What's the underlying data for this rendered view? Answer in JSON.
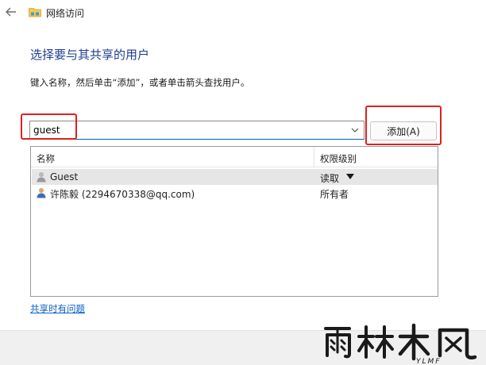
{
  "window": {
    "title": "网络访问",
    "back_icon": "back-arrow-icon",
    "folder_icon": "folder-network-icon"
  },
  "page": {
    "heading": "选择要与其共享的用户",
    "instruction": "键入名称，然后单击“添加”，或者单击箭头查找用户。"
  },
  "user_input": {
    "value": "guest",
    "dropdown_icon": "chevron-down-icon"
  },
  "add_button": {
    "label": "添加(A)"
  },
  "table": {
    "columns": [
      "名称",
      "权限级别"
    ],
    "rows": [
      {
        "name": "Guest",
        "permission": "读取",
        "selected": true,
        "has_dropdown": true
      },
      {
        "name": "许陈毅 (2294670338@qq.com)",
        "permission": "所有者",
        "selected": false,
        "has_dropdown": false
      }
    ]
  },
  "help_link": "共享时有问题",
  "watermark": {
    "text": "雨林木风",
    "subtext": "YLMF"
  },
  "colors": {
    "heading": "#1e3f8f",
    "link": "#0a5fc4",
    "highlight": "#e0201c",
    "selected_row": "#e6e6e6"
  }
}
